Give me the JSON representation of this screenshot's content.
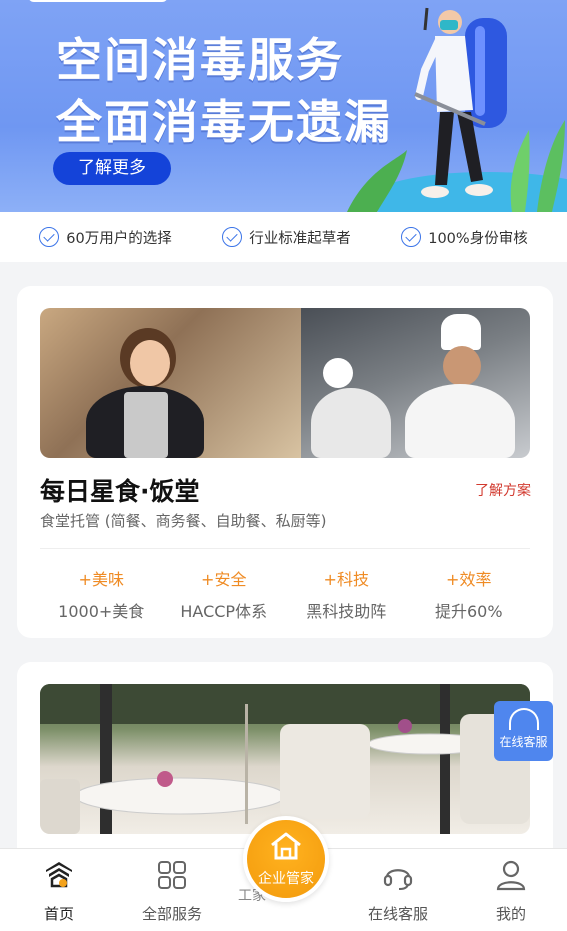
{
  "banner": {
    "line1": "空间消毒服务",
    "line2": "全面消毒无遗漏",
    "button": "了解更多"
  },
  "trust": [
    {
      "icon": "check-circle-icon",
      "text": "60万用户的选择"
    },
    {
      "icon": "check-circle-icon",
      "text": "行业标准起草者"
    },
    {
      "icon": "check-circle-icon",
      "text": "100%身份审核"
    }
  ],
  "card1": {
    "title": "每日星食·饭堂",
    "link": "了解方案",
    "subtitle": "食堂托管 (简餐、商务餐、自助餐、私厨等)",
    "features": [
      {
        "tag": "+美味",
        "desc": "1000+美食"
      },
      {
        "tag": "+安全",
        "desc": "HACCP体系"
      },
      {
        "tag": "+科技",
        "desc": "黑科技助阵"
      },
      {
        "tag": "+效率",
        "desc": "提升60%"
      }
    ]
  },
  "float_service": {
    "label": "在线客服",
    "icon": "headset-icon"
  },
  "nav": {
    "home": "首页",
    "all_services": "全部服务",
    "center": "企业管家",
    "center_partial": "工家",
    "support": "在线客服",
    "mine": "我的"
  },
  "colors": {
    "accent": "#1443d9",
    "orange": "#ef8b24",
    "link_red": "#d23a2f",
    "service_blue": "#4f86ee"
  }
}
